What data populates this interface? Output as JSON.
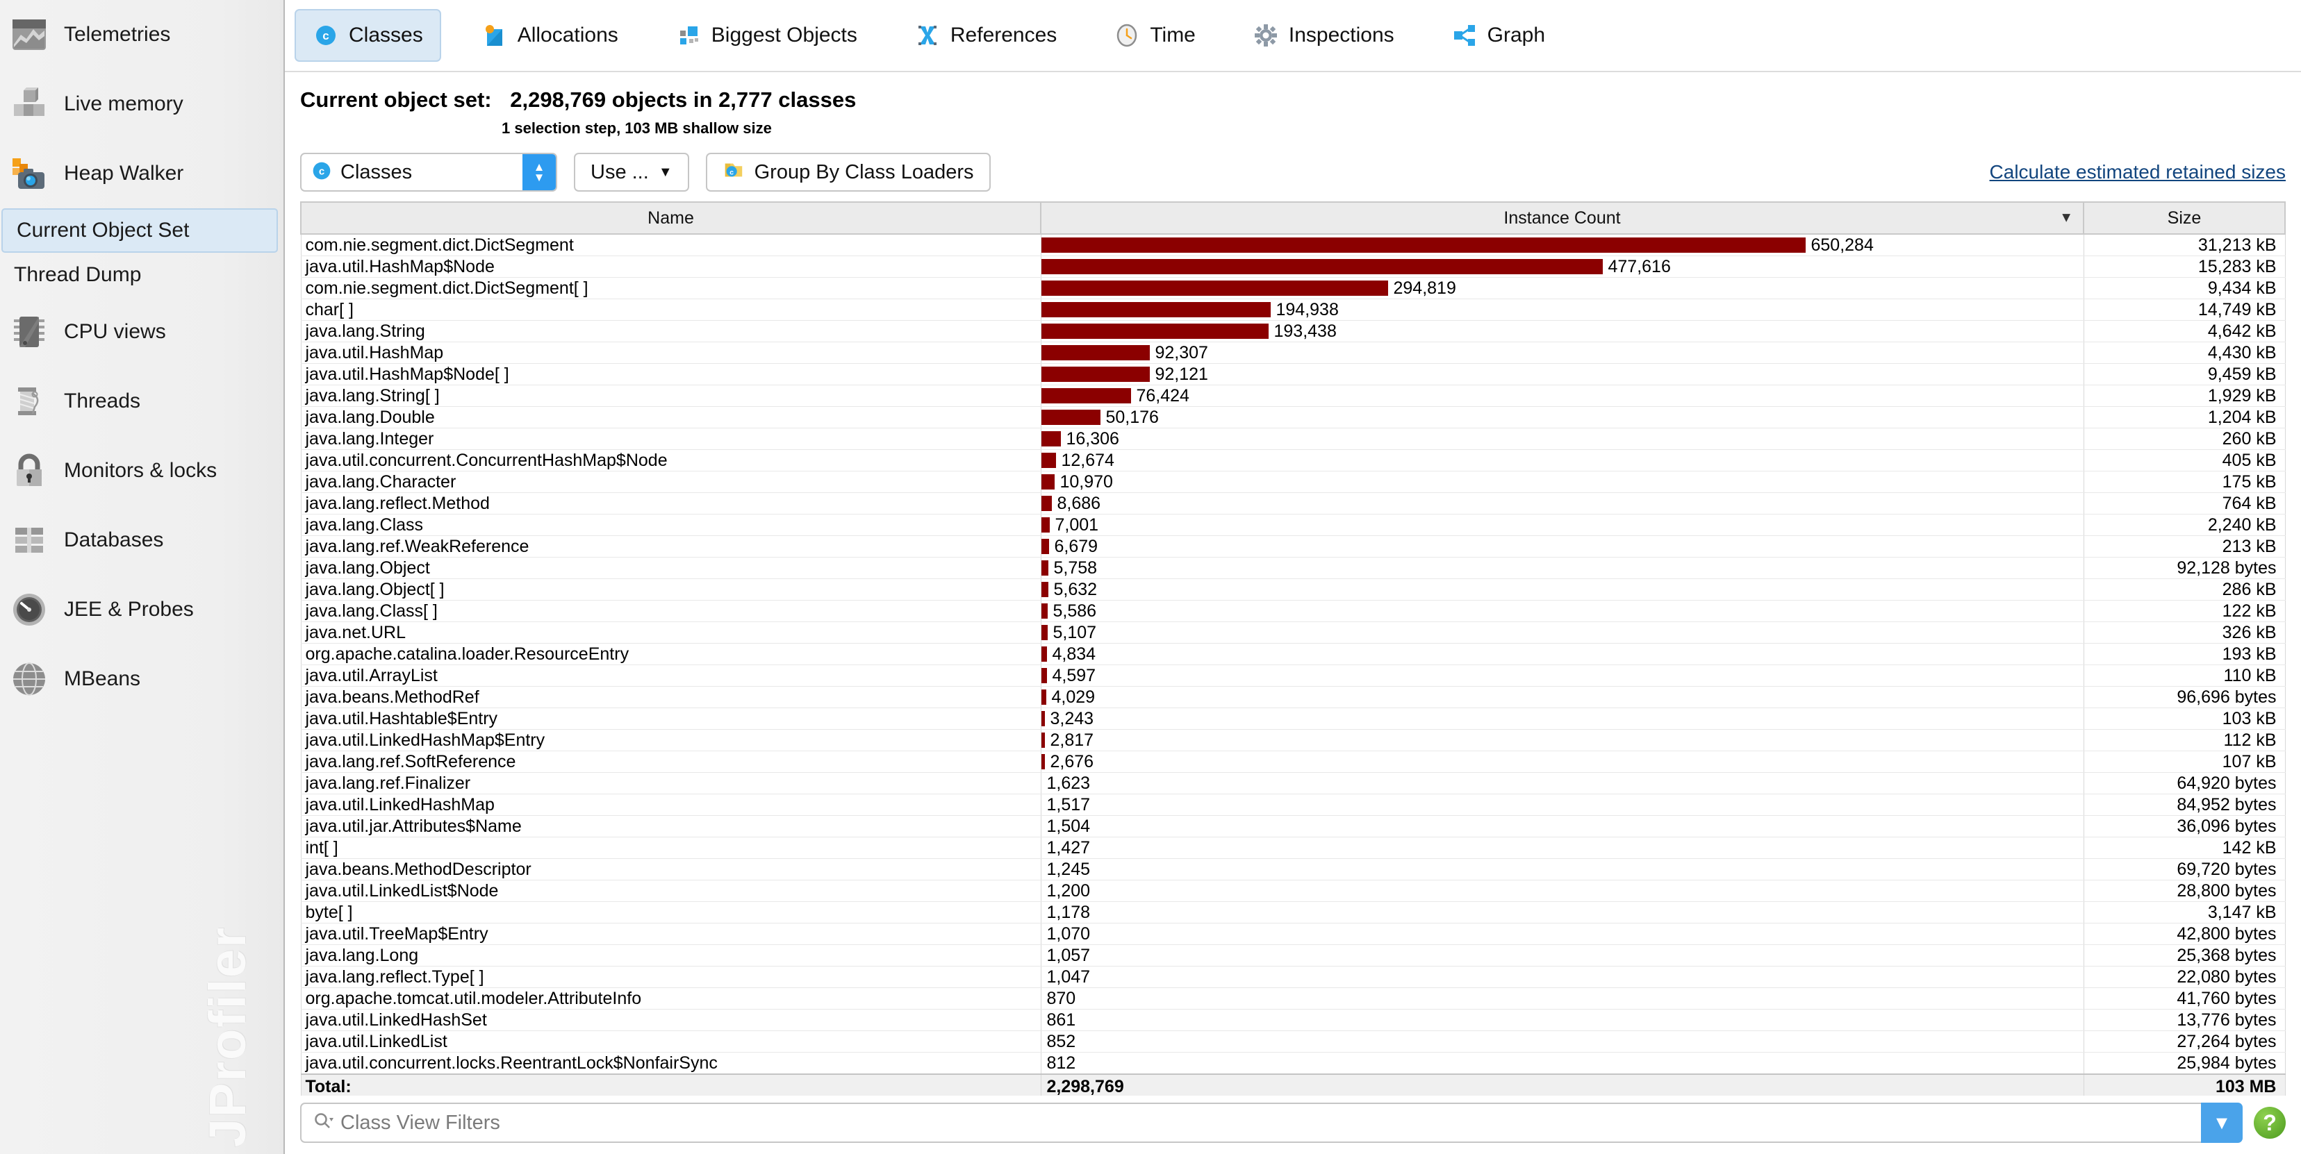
{
  "sidebar": {
    "items": [
      {
        "label": "Telemetries",
        "icon": "telemetries-icon"
      },
      {
        "label": "Live memory",
        "icon": "live-memory-icon"
      },
      {
        "label": "Heap Walker",
        "icon": "heap-walker-icon"
      }
    ],
    "sub_items": [
      {
        "label": "Current Object Set",
        "selected": true
      },
      {
        "label": "Thread Dump",
        "selected": false
      }
    ],
    "items2": [
      {
        "label": "CPU views",
        "icon": "cpu-chip-icon"
      },
      {
        "label": "Threads",
        "icon": "thread-spool-icon"
      },
      {
        "label": "Monitors & locks",
        "icon": "lock-icon"
      },
      {
        "label": "Databases",
        "icon": "database-icon"
      },
      {
        "label": "JEE & Probes",
        "icon": "gauge-icon"
      },
      {
        "label": "MBeans",
        "icon": "globe-icon"
      }
    ],
    "watermark": "JProfiler"
  },
  "tabs": [
    {
      "label": "Classes",
      "icon": "classes-icon",
      "active": true
    },
    {
      "label": "Allocations",
      "icon": "allocations-icon",
      "active": false
    },
    {
      "label": "Biggest Objects",
      "icon": "biggest-objects-icon",
      "active": false
    },
    {
      "label": "References",
      "icon": "references-icon",
      "active": false
    },
    {
      "label": "Time",
      "icon": "clock-icon",
      "active": false
    },
    {
      "label": "Inspections",
      "icon": "gear-icon",
      "active": false
    },
    {
      "label": "Graph",
      "icon": "graph-icon",
      "active": false
    }
  ],
  "header": {
    "label": "Current object set:",
    "summary": "2,298,769 objects in 2,777 classes",
    "subtitle": "1 selection step, 103 MB shallow size"
  },
  "toolbar": {
    "combo_value": "Classes",
    "use_button": "Use ...",
    "group_button": "Group By Class Loaders",
    "retained_link": "Calculate estimated retained sizes"
  },
  "table": {
    "columns": [
      "Name",
      "Instance Count",
      "Size"
    ],
    "sort_column": "Instance Count",
    "sort_direction": "desc",
    "bar_color": "#8b0000",
    "max_count": 650284,
    "rows": [
      {
        "name": "com.nie.segment.dict.DictSegment",
        "count": "650,284",
        "count_value": 650284,
        "size": "31,213 kB"
      },
      {
        "name": "java.util.HashMap$Node",
        "count": "477,616",
        "count_value": 477616,
        "size": "15,283 kB"
      },
      {
        "name": "com.nie.segment.dict.DictSegment[ ]",
        "count": "294,819",
        "count_value": 294819,
        "size": "9,434 kB"
      },
      {
        "name": "char[ ]",
        "count": "194,938",
        "count_value": 194938,
        "size": "14,749 kB"
      },
      {
        "name": "java.lang.String",
        "count": "193,438",
        "count_value": 193438,
        "size": "4,642 kB"
      },
      {
        "name": "java.util.HashMap",
        "count": "92,307",
        "count_value": 92307,
        "size": "4,430 kB"
      },
      {
        "name": "java.util.HashMap$Node[ ]",
        "count": "92,121",
        "count_value": 92121,
        "size": "9,459 kB"
      },
      {
        "name": "java.lang.String[ ]",
        "count": "76,424",
        "count_value": 76424,
        "size": "1,929 kB"
      },
      {
        "name": "java.lang.Double",
        "count": "50,176",
        "count_value": 50176,
        "size": "1,204 kB"
      },
      {
        "name": "java.lang.Integer",
        "count": "16,306",
        "count_value": 16306,
        "size": "260 kB"
      },
      {
        "name": "java.util.concurrent.ConcurrentHashMap$Node",
        "count": "12,674",
        "count_value": 12674,
        "size": "405 kB"
      },
      {
        "name": "java.lang.Character",
        "count": "10,970",
        "count_value": 10970,
        "size": "175 kB"
      },
      {
        "name": "java.lang.reflect.Method",
        "count": "8,686",
        "count_value": 8686,
        "size": "764 kB"
      },
      {
        "name": "java.lang.Class",
        "count": "7,001",
        "count_value": 7001,
        "size": "2,240 kB"
      },
      {
        "name": "java.lang.ref.WeakReference",
        "count": "6,679",
        "count_value": 6679,
        "size": "213 kB"
      },
      {
        "name": "java.lang.Object",
        "count": "5,758",
        "count_value": 5758,
        "size": "92,128 bytes"
      },
      {
        "name": "java.lang.Object[ ]",
        "count": "5,632",
        "count_value": 5632,
        "size": "286 kB"
      },
      {
        "name": "java.lang.Class[ ]",
        "count": "5,586",
        "count_value": 5586,
        "size": "122 kB"
      },
      {
        "name": "java.net.URL",
        "count": "5,107",
        "count_value": 5107,
        "size": "326 kB"
      },
      {
        "name": "org.apache.catalina.loader.ResourceEntry",
        "count": "4,834",
        "count_value": 4834,
        "size": "193 kB"
      },
      {
        "name": "java.util.ArrayList",
        "count": "4,597",
        "count_value": 4597,
        "size": "110 kB"
      },
      {
        "name": "java.beans.MethodRef",
        "count": "4,029",
        "count_value": 4029,
        "size": "96,696 bytes"
      },
      {
        "name": "java.util.Hashtable$Entry",
        "count": "3,243",
        "count_value": 3243,
        "size": "103 kB"
      },
      {
        "name": "java.util.LinkedHashMap$Entry",
        "count": "2,817",
        "count_value": 2817,
        "size": "112 kB"
      },
      {
        "name": "java.lang.ref.SoftReference",
        "count": "2,676",
        "count_value": 2676,
        "size": "107 kB"
      },
      {
        "name": "java.lang.ref.Finalizer",
        "count": "1,623",
        "count_value": 1623,
        "size": "64,920 bytes"
      },
      {
        "name": "java.util.LinkedHashMap",
        "count": "1,517",
        "count_value": 1517,
        "size": "84,952 bytes"
      },
      {
        "name": "java.util.jar.Attributes$Name",
        "count": "1,504",
        "count_value": 1504,
        "size": "36,096 bytes"
      },
      {
        "name": "int[ ]",
        "count": "1,427",
        "count_value": 1427,
        "size": "142 kB"
      },
      {
        "name": "java.beans.MethodDescriptor",
        "count": "1,245",
        "count_value": 1245,
        "size": "69,720 bytes"
      },
      {
        "name": "java.util.LinkedList$Node",
        "count": "1,200",
        "count_value": 1200,
        "size": "28,800 bytes"
      },
      {
        "name": "byte[ ]",
        "count": "1,178",
        "count_value": 1178,
        "size": "3,147 kB"
      },
      {
        "name": "java.util.TreeMap$Entry",
        "count": "1,070",
        "count_value": 1070,
        "size": "42,800 bytes"
      },
      {
        "name": "java.lang.Long",
        "count": "1,057",
        "count_value": 1057,
        "size": "25,368 bytes"
      },
      {
        "name": "java.lang.reflect.Type[ ]",
        "count": "1,047",
        "count_value": 1047,
        "size": "22,080 bytes"
      },
      {
        "name": "org.apache.tomcat.util.modeler.AttributeInfo",
        "count": "870",
        "count_value": 870,
        "size": "41,760 bytes"
      },
      {
        "name": "java.util.LinkedHashSet",
        "count": "861",
        "count_value": 861,
        "size": "13,776 bytes"
      },
      {
        "name": "java.util.LinkedList",
        "count": "852",
        "count_value": 852,
        "size": "27,264 bytes"
      },
      {
        "name": "java.util.concurrent.locks.ReentrantLock$NonfairSync",
        "count": "812",
        "count_value": 812,
        "size": "25,984 bytes"
      }
    ],
    "total": {
      "name": "Total:",
      "count": "2,298,769",
      "size": "103 MB"
    }
  },
  "filter": {
    "placeholder": "Class View Filters",
    "dropdown_icon": "chevron-down-icon",
    "help_icon": "help-icon",
    "help_label": "?"
  }
}
